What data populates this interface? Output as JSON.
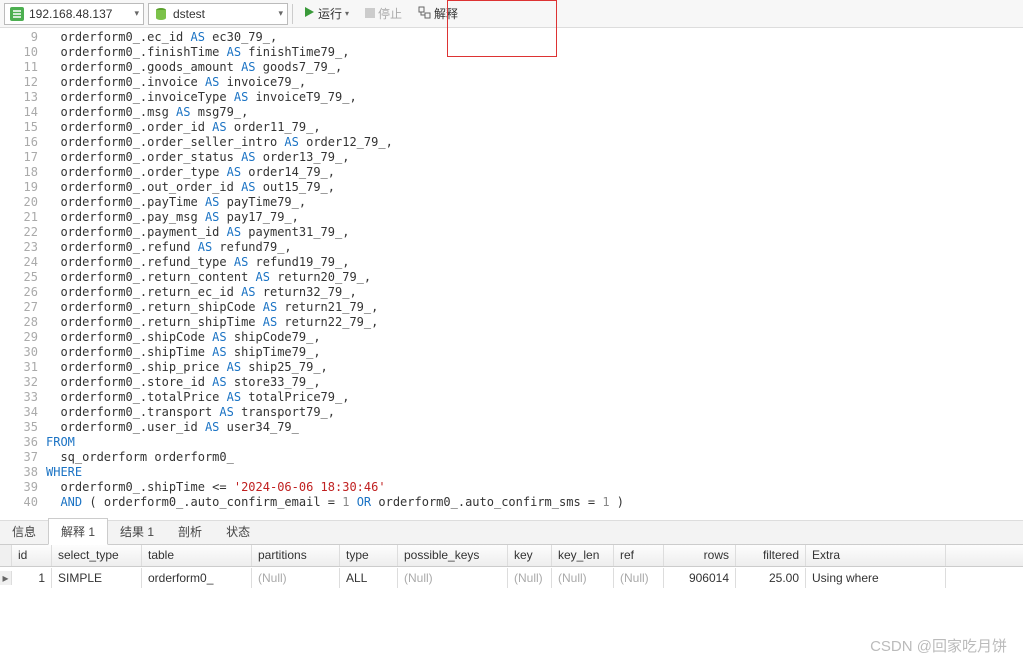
{
  "toolbar": {
    "server": "192.168.48.137",
    "database": "dstest",
    "run": "运行",
    "stop": "停止",
    "explain": "解释"
  },
  "gutter_start": 9,
  "code_lines": [
    [
      [
        "  orderform0_.ec_id "
      ],
      [
        "kw",
        "AS"
      ],
      [
        " ec30_79_,"
      ]
    ],
    [
      [
        "  orderform0_.finishTime "
      ],
      [
        "kw",
        "AS"
      ],
      [
        " finishTime79_,"
      ]
    ],
    [
      [
        "  orderform0_.goods_amount "
      ],
      [
        "kw",
        "AS"
      ],
      [
        " goods7_79_,"
      ]
    ],
    [
      [
        "  orderform0_.invoice "
      ],
      [
        "kw",
        "AS"
      ],
      [
        " invoice79_,"
      ]
    ],
    [
      [
        "  orderform0_.invoiceType "
      ],
      [
        "kw",
        "AS"
      ],
      [
        " invoiceT9_79_,"
      ]
    ],
    [
      [
        "  orderform0_.msg "
      ],
      [
        "kw",
        "AS"
      ],
      [
        " msg79_,"
      ]
    ],
    [
      [
        "  orderform0_.order_id "
      ],
      [
        "kw",
        "AS"
      ],
      [
        " order11_79_,"
      ]
    ],
    [
      [
        "  orderform0_.order_seller_intro "
      ],
      [
        "kw",
        "AS"
      ],
      [
        " order12_79_,"
      ]
    ],
    [
      [
        "  orderform0_.order_status "
      ],
      [
        "kw",
        "AS"
      ],
      [
        " order13_79_,"
      ]
    ],
    [
      [
        "  orderform0_.order_type "
      ],
      [
        "kw",
        "AS"
      ],
      [
        " order14_79_,"
      ]
    ],
    [
      [
        "  orderform0_.out_order_id "
      ],
      [
        "kw",
        "AS"
      ],
      [
        " out15_79_,"
      ]
    ],
    [
      [
        "  orderform0_.payTime "
      ],
      [
        "kw",
        "AS"
      ],
      [
        " payTime79_,"
      ]
    ],
    [
      [
        "  orderform0_.pay_msg "
      ],
      [
        "kw",
        "AS"
      ],
      [
        " pay17_79_,"
      ]
    ],
    [
      [
        "  orderform0_.payment_id "
      ],
      [
        "kw",
        "AS"
      ],
      [
        " payment31_79_,"
      ]
    ],
    [
      [
        "  orderform0_.refund "
      ],
      [
        "kw",
        "AS"
      ],
      [
        " refund79_,"
      ]
    ],
    [
      [
        "  orderform0_.refund_type "
      ],
      [
        "kw",
        "AS"
      ],
      [
        " refund19_79_,"
      ]
    ],
    [
      [
        "  orderform0_.return_content "
      ],
      [
        "kw",
        "AS"
      ],
      [
        " return20_79_,"
      ]
    ],
    [
      [
        "  orderform0_.return_ec_id "
      ],
      [
        "kw",
        "AS"
      ],
      [
        " return32_79_,"
      ]
    ],
    [
      [
        "  orderform0_.return_shipCode "
      ],
      [
        "kw",
        "AS"
      ],
      [
        " return21_79_,"
      ]
    ],
    [
      [
        "  orderform0_.return_shipTime "
      ],
      [
        "kw",
        "AS"
      ],
      [
        " return22_79_,"
      ]
    ],
    [
      [
        "  orderform0_.shipCode "
      ],
      [
        "kw",
        "AS"
      ],
      [
        " shipCode79_,"
      ]
    ],
    [
      [
        "  orderform0_.shipTime "
      ],
      [
        "kw",
        "AS"
      ],
      [
        " shipTime79_,"
      ]
    ],
    [
      [
        "  orderform0_.ship_price "
      ],
      [
        "kw",
        "AS"
      ],
      [
        " ship25_79_,"
      ]
    ],
    [
      [
        "  orderform0_.store_id "
      ],
      [
        "kw",
        "AS"
      ],
      [
        " store33_79_,"
      ]
    ],
    [
      [
        "  orderform0_.totalPrice "
      ],
      [
        "kw",
        "AS"
      ],
      [
        " totalPrice79_,"
      ]
    ],
    [
      [
        "  orderform0_.transport "
      ],
      [
        "kw",
        "AS"
      ],
      [
        " transport79_,"
      ]
    ],
    [
      [
        "  orderform0_.user_id "
      ],
      [
        "kw",
        "AS"
      ],
      [
        " user34_79_ "
      ]
    ],
    [
      [
        "kw",
        "FROM"
      ]
    ],
    [
      [
        "  sq_orderform orderform0_ "
      ]
    ],
    [
      [
        "kw",
        "WHERE"
      ]
    ],
    [
      [
        "  orderform0_.shipTime <= "
      ],
      [
        "str",
        "'2024-06-06 18:30:46'"
      ],
      [
        " "
      ]
    ],
    [
      [
        "  "
      ],
      [
        "kw",
        "AND"
      ],
      [
        " ( orderform0_.auto_confirm_email = "
      ],
      [
        "num",
        "1"
      ],
      [
        " "
      ],
      [
        "kw",
        "OR"
      ],
      [
        " orderform0_.auto_confirm_sms = "
      ],
      [
        "num",
        "1"
      ],
      [
        " ) "
      ]
    ]
  ],
  "tabs": [
    "信息",
    "解释 1",
    "结果 1",
    "剖析",
    "状态"
  ],
  "active_tab": 1,
  "grid": {
    "headers": [
      "id",
      "select_type",
      "table",
      "partitions",
      "type",
      "possible_keys",
      "key",
      "key_len",
      "ref",
      "rows",
      "filtered",
      "Extra"
    ],
    "row": {
      "id": "1",
      "select_type": "SIMPLE",
      "table": "orderform0_",
      "partitions": "(Null)",
      "type": "ALL",
      "possible_keys": "(Null)",
      "key": "(Null)",
      "key_len": "(Null)",
      "ref": "(Null)",
      "rows": "906014",
      "filtered": "25.00",
      "extra": "Using where"
    }
  },
  "watermark": "CSDN @回家吃月饼"
}
